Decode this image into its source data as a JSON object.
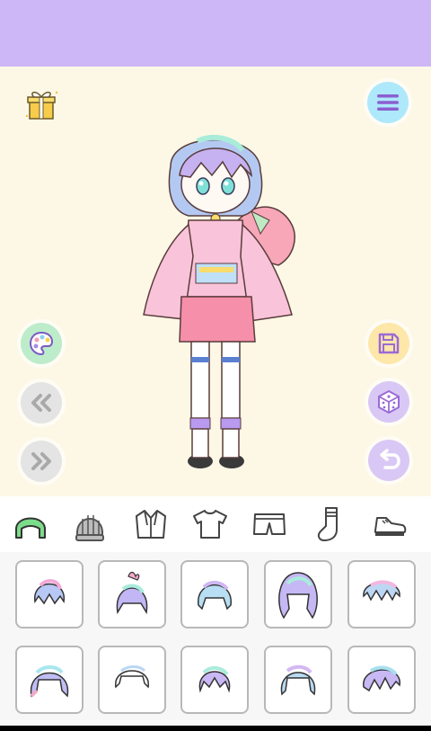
{
  "colors": {
    "topbar": "#cdb7f7",
    "stage": "#fdf8e6",
    "menu_button": "#aee8fb",
    "palette_button": "#bdeccb",
    "nav_button": "#e4e4e4",
    "save_button": "#fde7a9",
    "action_button": "#d9c8f5",
    "icon_purple": "#9b6bd6"
  },
  "stage": {
    "left_buttons": [
      {
        "name": "palette-button",
        "icon": "palette-icon"
      },
      {
        "name": "previous-button",
        "icon": "double-chevron-left-icon"
      },
      {
        "name": "next-button",
        "icon": "double-chevron-right-icon"
      }
    ],
    "right_buttons": [
      {
        "name": "save-button",
        "icon": "floppy-disk-icon"
      },
      {
        "name": "random-button",
        "icon": "dice-icon"
      },
      {
        "name": "undo-button",
        "icon": "undo-arrow-icon"
      }
    ],
    "top_left": {
      "icon": "gift-icon"
    },
    "top_right": {
      "icon": "menu-icon"
    }
  },
  "categories": [
    {
      "name": "hair",
      "icon": "hair-icon",
      "selected": true
    },
    {
      "name": "hat",
      "icon": "knit-hat-icon",
      "selected": false
    },
    {
      "name": "jacket",
      "icon": "jacket-icon",
      "selected": false
    },
    {
      "name": "shirt",
      "icon": "tshirt-icon",
      "selected": false
    },
    {
      "name": "shorts",
      "icon": "shorts-icon",
      "selected": false
    },
    {
      "name": "socks",
      "icon": "sock-icon",
      "selected": false
    },
    {
      "name": "shoes",
      "icon": "shoe-icon",
      "selected": false
    }
  ],
  "hair_options_count_visible": 10
}
